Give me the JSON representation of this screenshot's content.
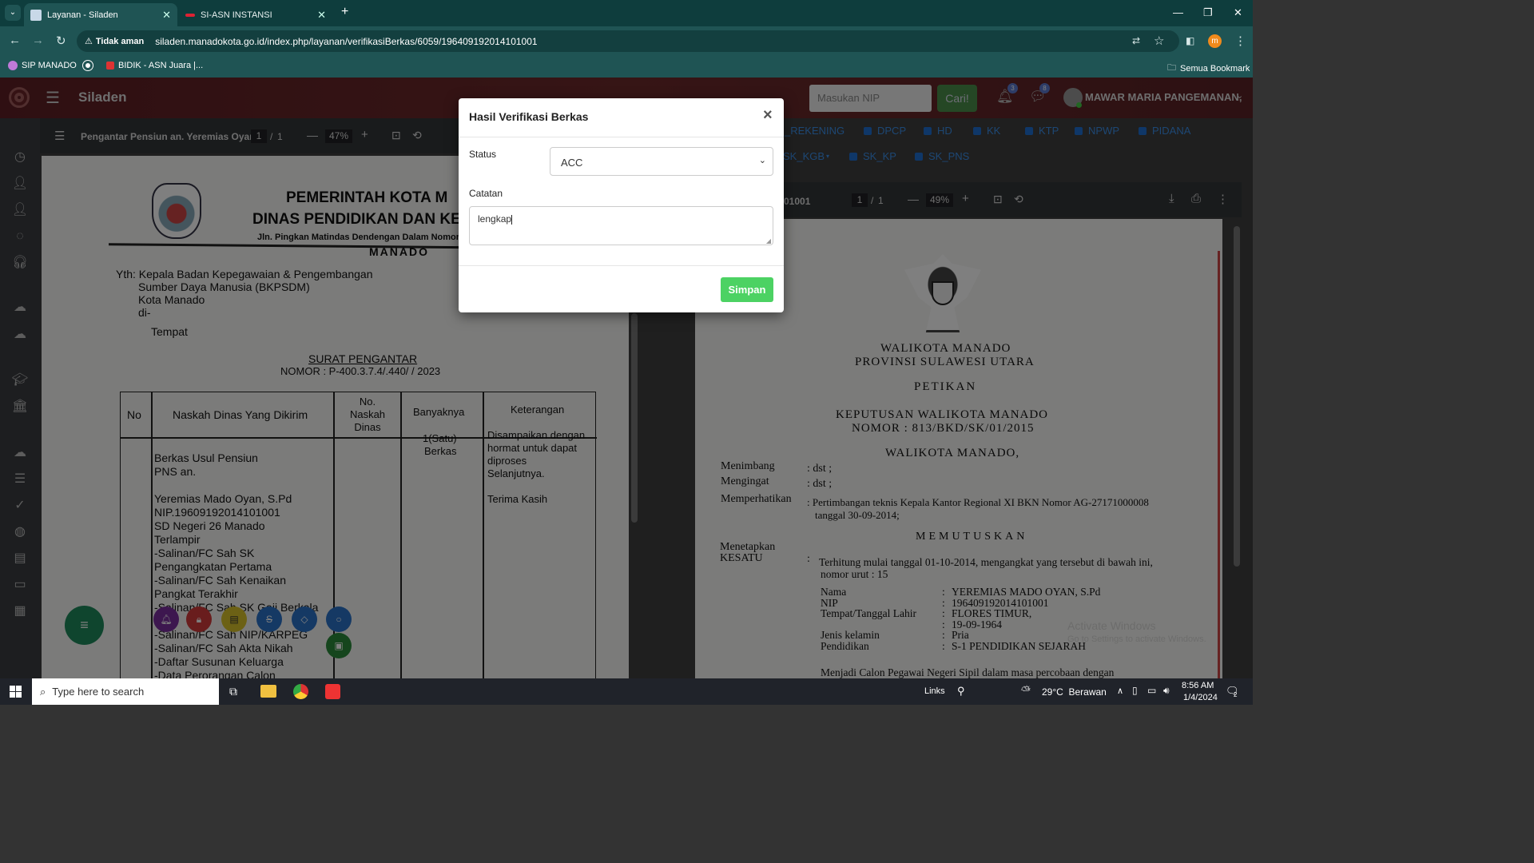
{
  "browser": {
    "tabs": [
      {
        "label": "Layanan - Siladen",
        "active": true
      },
      {
        "label": "SI-ASN INSTANSI",
        "active": false
      }
    ],
    "security_label": "Tidak aman",
    "url": "siladen.manadokota.go.id/index.php/layanan/verifikasiBerkas/6059/196409192014101001",
    "bookmarks": [
      {
        "label": "SIP MANADO"
      },
      {
        "label": ""
      },
      {
        "label": "BIDIK - ASN Juara |..."
      }
    ],
    "all_bookmarks_label": "Semua Bookmark",
    "profile_initial": "m"
  },
  "app": {
    "title": "Siladen",
    "search_placeholder": "Masukan NIP",
    "search_button": "Cari!",
    "notif_count": "3",
    "message_count": "8",
    "user_name": "MAWAR MARIA PANGEMANAN,"
  },
  "doc_chips": {
    "row1": [
      "_REKENING",
      "DPCP",
      "HD",
      "KK",
      "KTP",
      "NPWP",
      "PIDANA"
    ],
    "row2": [
      "SK_KGB",
      "SK_KP",
      "SK_PNS"
    ]
  },
  "left_viewer": {
    "title": "Pengantar Pensiun an. Yeremias Oyan",
    "page": "1",
    "pages": "1",
    "zoom": "47%",
    "doc": {
      "head1": "PEMERINTAH KOTA M",
      "head2": "DINAS PENDIDIKAN DAN KE",
      "head3": "Jln. Pingkan Matindas Dendengan Dalam Nomor 13",
      "head4": "MANADO",
      "yth1": "Yth: Kepala Badan Kepegawaian & Pengembangan",
      "yth2": "Sumber Daya Manusia (BKPSDM)",
      "yth3": "Kota Manado",
      "yth4": "di-",
      "yth5": "Tempat",
      "surat": "SURAT PENGANTAR",
      "nomor": "NOMOR : P-400.3.7.4/.440/ / 2023",
      "col_no": "No",
      "col_naskah": "Naskah Dinas Yang Dikirim",
      "col_nonaskah": "No. Naskah Dinas",
      "col_banyak": "Banyaknya",
      "col_ket": "Keterangan",
      "items": [
        "Berkas Usul Pensiun",
        "PNS an.",
        "",
        "Yeremias Mado Oyan, S.Pd",
        "NIP.19609192014101001",
        "SD Negeri 26 Manado",
        "Terlampir",
        "-Salinan/FC Sah  SK",
        "Pengangkatan Pertama",
        "-Salinan/FC  Sah Kenaikan",
        "Pangkat Terakhir",
        "-Salinan/FC Sah SK Gaji Berkala",
        "",
        "-Salinan/FC Sah NIP/KARPEG",
        "-Salinan/FC Sah Akta Nikah",
        "-Daftar Susunan Keluarga",
        "-Data Perorangan Calon"
      ],
      "banyak1": "1(Satu)",
      "banyak2": "Berkas",
      "ket": [
        "Disampaikan dengan",
        "hormat untuk dapat",
        "diproses",
        "Selanjutnya.",
        "",
        "Terima Kasih"
      ]
    }
  },
  "right_viewer": {
    "title": "01001",
    "page": "1",
    "pages": "1",
    "zoom": "49%",
    "doc": {
      "l1": "WALIKOTA MANADO",
      "l2": "PROVINSI SULAWESI UTARA",
      "l3": "PETIKAN",
      "l4": "KEPUTUSAN WALIKOTA MANADO",
      "l5": "NOMOR : 813/BKD/SK/01/2015",
      "l6": "WALIKOTA MANADO,",
      "menimbang": "Menimbang",
      "mengingat": "Mengingat",
      "memperhatikan": "Memperhatikan",
      "dst": ": dst ;",
      "pertimbangan1": ": Pertimbangan teknis Kepala Kantor Regional XI BKN Nomor AG-27171000008",
      "pertimbangan2": "tanggal 30-09-2014;",
      "memutuskan": "MEMUTUSKAN",
      "menetapkan": "Menetapkan",
      "kesatu": "KESATU",
      "terhitung1": "Terhitung mulai tanggal 01-10-2014, mengangkat yang tersebut di bawah ini,",
      "terhitung2": "nomor urut : 15",
      "fields": [
        {
          "k": "Nama",
          "v": "YEREMIAS MADO OYAN, S.Pd"
        },
        {
          "k": "NIP",
          "v": "196409192014101001"
        },
        {
          "k": "Tempat/Tanggal Lahir",
          "v": "FLORES TIMUR,"
        },
        {
          "k": "",
          "v": "19-09-1964"
        },
        {
          "k": "Jenis kelamin",
          "v": "Pria"
        },
        {
          "k": "Pendidikan",
          "v": "S-1 PENDIDIKAN SEJARAH"
        }
      ],
      "last": "Menjadi Calon Pegawai Negeri Sipil dalam masa percobaan dengan"
    },
    "watermark1": "Activate Windows",
    "watermark2": "Go to Settings to activate Windows."
  },
  "modal": {
    "title": "Hasil Verifikasi Berkas",
    "close": "×",
    "status_label": "Status",
    "status_value": "ACC",
    "catatan_label": "Catatan",
    "catatan_value": "lengkap",
    "save_button": "Simpan"
  },
  "fab": {
    "menu": "≡"
  },
  "taskbar": {
    "search_placeholder": "Type here to search",
    "links": "Links",
    "weather": "29°C  Berawan",
    "time": "8:56 AM",
    "date": "1/4/2024",
    "notif": "2"
  },
  "colors": {
    "app_header": "#6b2428",
    "save_green": "#4cd263",
    "search_green": "#4caf50",
    "chip_blue": "#1e6fd0"
  }
}
